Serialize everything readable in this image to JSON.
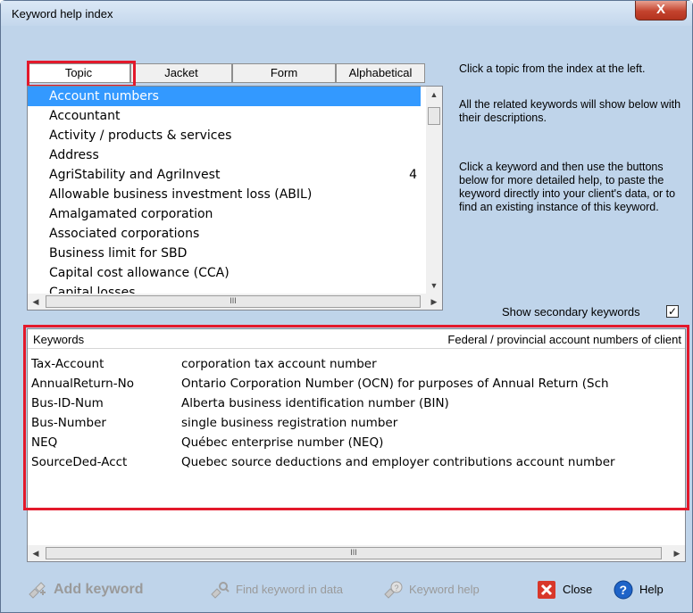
{
  "window": {
    "title": "Keyword help index",
    "close_glyph": "X"
  },
  "tabs": [
    {
      "label": "Topic",
      "selected": true
    },
    {
      "label": "Jacket",
      "selected": false
    },
    {
      "label": "Form",
      "selected": false
    },
    {
      "label": "Alphabetical",
      "selected": false
    }
  ],
  "topics": [
    {
      "label": "Account numbers",
      "count": "",
      "selected": true
    },
    {
      "label": "Accountant",
      "count": ""
    },
    {
      "label": "Activity / products & services",
      "count": ""
    },
    {
      "label": "Address",
      "count": ""
    },
    {
      "label": "AgriStability and AgriInvest",
      "count": "4"
    },
    {
      "label": "Allowable business investment loss (ABIL)",
      "count": ""
    },
    {
      "label": "Amalgamated corporation",
      "count": ""
    },
    {
      "label": "Associated corporations",
      "count": ""
    },
    {
      "label": "Business limit for SBD",
      "count": ""
    },
    {
      "label": "Capital cost allowance (CCA)",
      "count": ""
    },
    {
      "label": "Capital losses",
      "count": ""
    }
  ],
  "instructions": {
    "p1": "Click a topic from the index at the left.",
    "p2": "All the related keywords will show below with their descriptions.",
    "p3": "Click a keyword and then use the buttons below for more detailed help, to paste the keyword directly into your client's data, or to find an existing instance of this keyword."
  },
  "show_secondary": {
    "label": "Show secondary keywords",
    "checked": true,
    "mark": "✓"
  },
  "keywords_panel": {
    "header_left": "Keywords",
    "header_right": "Federal / provincial account numbers of client",
    "rows": [
      {
        "keyword": "Tax-Account",
        "description": "corporation tax account number"
      },
      {
        "keyword": "AnnualReturn-No",
        "description": "Ontario Corporation Number (OCN) for purposes of Annual Return (Sch"
      },
      {
        "keyword": "Bus-ID-Num",
        "description": "Alberta business identification number (BIN)"
      },
      {
        "keyword": "Bus-Number",
        "description": "single business registration number"
      },
      {
        "keyword": "NEQ",
        "description": "Québec enterprise number (NEQ)"
      },
      {
        "keyword": "SourceDed-Acct",
        "description": "Quebec source deductions and employer contributions account number"
      }
    ]
  },
  "buttons": {
    "add_keyword": "Add keyword",
    "find_keyword": "Find keyword in data",
    "keyword_help": "Keyword help",
    "close": "Close",
    "help": "Help"
  },
  "scroll_grip": "III",
  "colors": {
    "selection": "#3399ff",
    "highlight_box": "#e3192b",
    "close_red": "#d8372a",
    "help_blue": "#1e63c8"
  }
}
